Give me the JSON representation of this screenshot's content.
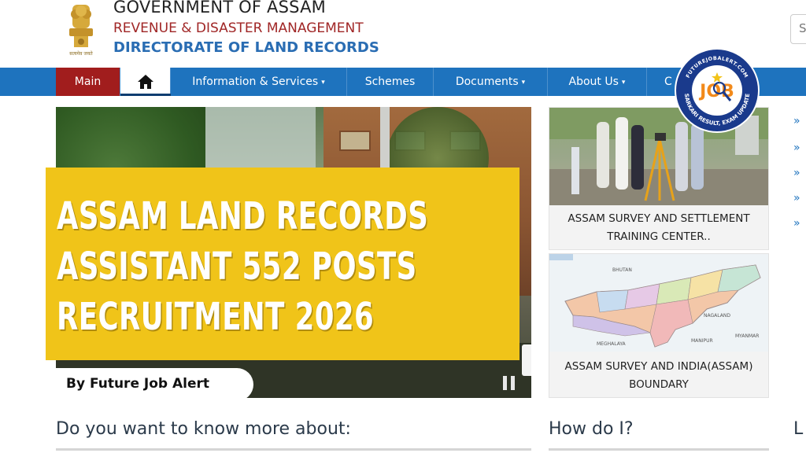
{
  "header": {
    "emblem_caption": "सत्यमेव जयते",
    "government": "GOVERNMENT OF ASSAM",
    "department": "REVENUE & DISASTER MANAGEMENT",
    "directorate": "DIRECTORATE OF LAND RECORDS",
    "search_placeholder": "S"
  },
  "nav": {
    "main": "Main",
    "info": "Information & Services",
    "schemes": "Schemes",
    "documents": "Documents",
    "about": "About Us",
    "contact": "C",
    "caret": "▾"
  },
  "banner": {
    "lines": [
      "ASSAM LAND RECORDS",
      "ASSIST ANT 552 POSTS",
      "RECRUITMENT 2026"
    ],
    "credit": "By Future Job Alert"
  },
  "cards": [
    {
      "caption_line1": "ASSAM SURVEY AND SETTLEMENT",
      "caption_line2": "TRAINING CENTER.."
    },
    {
      "caption_line1": "ASSAM SURVEY AND INDIA(ASSAM)",
      "caption_line2": "BOUNDARY"
    }
  ],
  "map_labels": [
    "BHUTAN",
    "NAGALAND",
    "MEGHALAYA",
    "MANIPUR",
    "MYANMAR"
  ],
  "side_links": [
    "»",
    "»",
    "»",
    "»",
    "»",
    "»"
  ],
  "badge": {
    "top_text": "FUTUREJOBALERT.COM",
    "main": "JOB",
    "bottom_text": "SARKARI RESULT, EXAM UPDATE"
  },
  "sections": {
    "know_more": "Do you want to know more about:",
    "how_do_i": "How do I?",
    "third": "L"
  },
  "colors": {
    "nav_blue": "#1e73be",
    "main_red": "#a11d1d",
    "banner_yellow": "#f0c419",
    "directorate_blue": "#2a6db3",
    "department_red": "#a02626"
  }
}
